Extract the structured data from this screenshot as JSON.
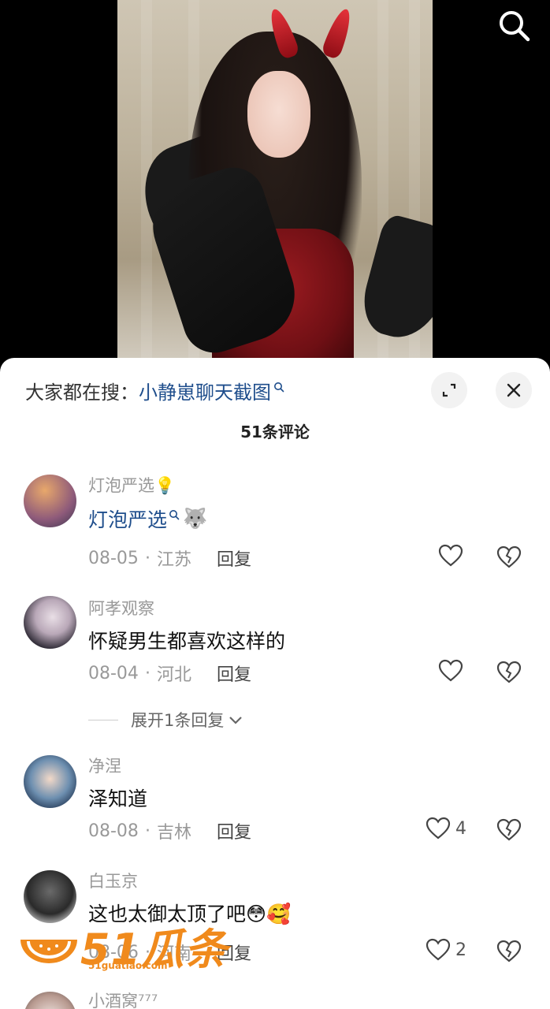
{
  "video": {
    "colors": {
      "horn": "#c41a24",
      "dress": "#8e1419",
      "background": "#000000"
    }
  },
  "search_button": {
    "icon": "search-icon"
  },
  "sheet": {
    "suggest_prefix": "大家都在搜：",
    "suggest_link": "小静崽聊天截图",
    "comment_count": "51条评论"
  },
  "comments": [
    {
      "user": "灯泡严选💡",
      "text": "灯泡严选",
      "text_emoji": "🐺",
      "date": "08-05",
      "location": "江苏",
      "reply": "回复",
      "likes": ""
    },
    {
      "user": "阿孝观察",
      "text": "怀疑男生都喜欢这样的",
      "date": "08-04",
      "location": "河北",
      "reply": "回复",
      "likes": "",
      "expand_replies": "展开1条回复"
    },
    {
      "user": "净涅",
      "text": "泽知道",
      "date": "08-08",
      "location": "吉林",
      "reply": "回复",
      "likes": "4"
    },
    {
      "user": "白玉京",
      "text": "这也太御太顶了吧😳🥰",
      "date": "08-06",
      "location": "河南",
      "reply": "回复",
      "likes": "2"
    },
    {
      "user": "小酒窝⁷⁷⁷"
    }
  ],
  "watermark": {
    "text": "51瓜条",
    "url": "51guatiao.com"
  },
  "accent_link_color": "#1f4e8c"
}
